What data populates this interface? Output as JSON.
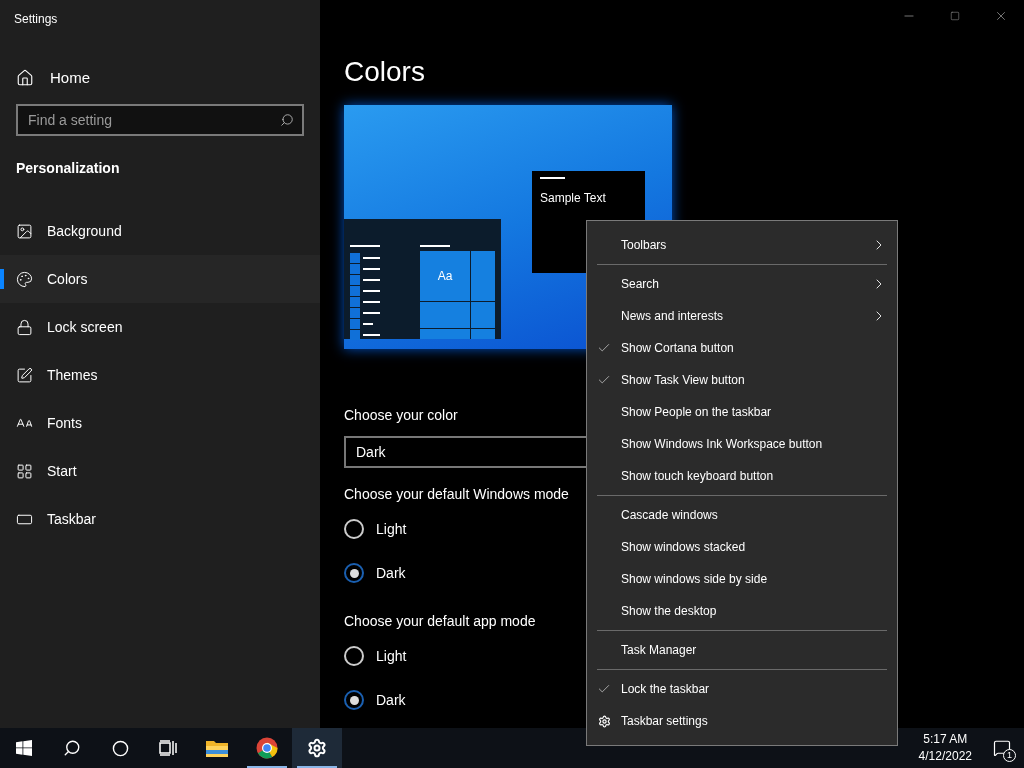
{
  "window": {
    "title": "Settings"
  },
  "sidebar": {
    "home": "Home",
    "search": {
      "placeholder": "Find a setting"
    },
    "section": "Personalization",
    "items": [
      {
        "label": "Background",
        "selected": false
      },
      {
        "label": "Colors",
        "selected": true
      },
      {
        "label": "Lock screen",
        "selected": false
      },
      {
        "label": "Themes",
        "selected": false
      },
      {
        "label": "Fonts",
        "selected": false
      },
      {
        "label": "Start",
        "selected": false
      },
      {
        "label": "Taskbar",
        "selected": false
      }
    ]
  },
  "content": {
    "title": "Colors",
    "preview": {
      "window_text": "Sample Text",
      "tile_text": "Aa"
    },
    "color_label": "Choose your color",
    "color_value": "Dark",
    "groups": [
      {
        "label": "Choose your default Windows mode",
        "options": [
          {
            "label": "Light",
            "selected": false
          },
          {
            "label": "Dark",
            "selected": true
          }
        ]
      },
      {
        "label": "Choose your default app mode",
        "options": [
          {
            "label": "Light",
            "selected": false
          },
          {
            "label": "Dark",
            "selected": true
          }
        ]
      }
    ]
  },
  "context_menu": [
    {
      "kind": "submenu",
      "label": "Toolbars"
    },
    {
      "kind": "separator"
    },
    {
      "kind": "submenu",
      "label": "Search"
    },
    {
      "kind": "submenu",
      "label": "News and interests"
    },
    {
      "kind": "check",
      "label": "Show Cortana button",
      "checked": true
    },
    {
      "kind": "check",
      "label": "Show Task View button",
      "checked": true
    },
    {
      "kind": "check",
      "label": "Show People on the taskbar",
      "checked": false
    },
    {
      "kind": "check",
      "label": "Show Windows Ink Workspace button",
      "checked": false
    },
    {
      "kind": "check",
      "label": "Show touch keyboard button",
      "checked": false
    },
    {
      "kind": "separator"
    },
    {
      "kind": "command",
      "label": "Cascade windows"
    },
    {
      "kind": "command",
      "label": "Show windows stacked"
    },
    {
      "kind": "command",
      "label": "Show windows side by side"
    },
    {
      "kind": "command",
      "label": "Show the desktop"
    },
    {
      "kind": "separator"
    },
    {
      "kind": "command",
      "label": "Task Manager"
    },
    {
      "kind": "separator"
    },
    {
      "kind": "check",
      "label": "Lock the taskbar",
      "checked": true
    },
    {
      "kind": "settings",
      "label": "Taskbar settings"
    }
  ],
  "taskbar": {
    "apps": [
      {
        "running": false
      },
      {
        "running": true
      },
      {
        "running": true
      }
    ],
    "clock": {
      "time": "5:17 AM",
      "date": "4/12/2022"
    },
    "notifications": "1"
  }
}
